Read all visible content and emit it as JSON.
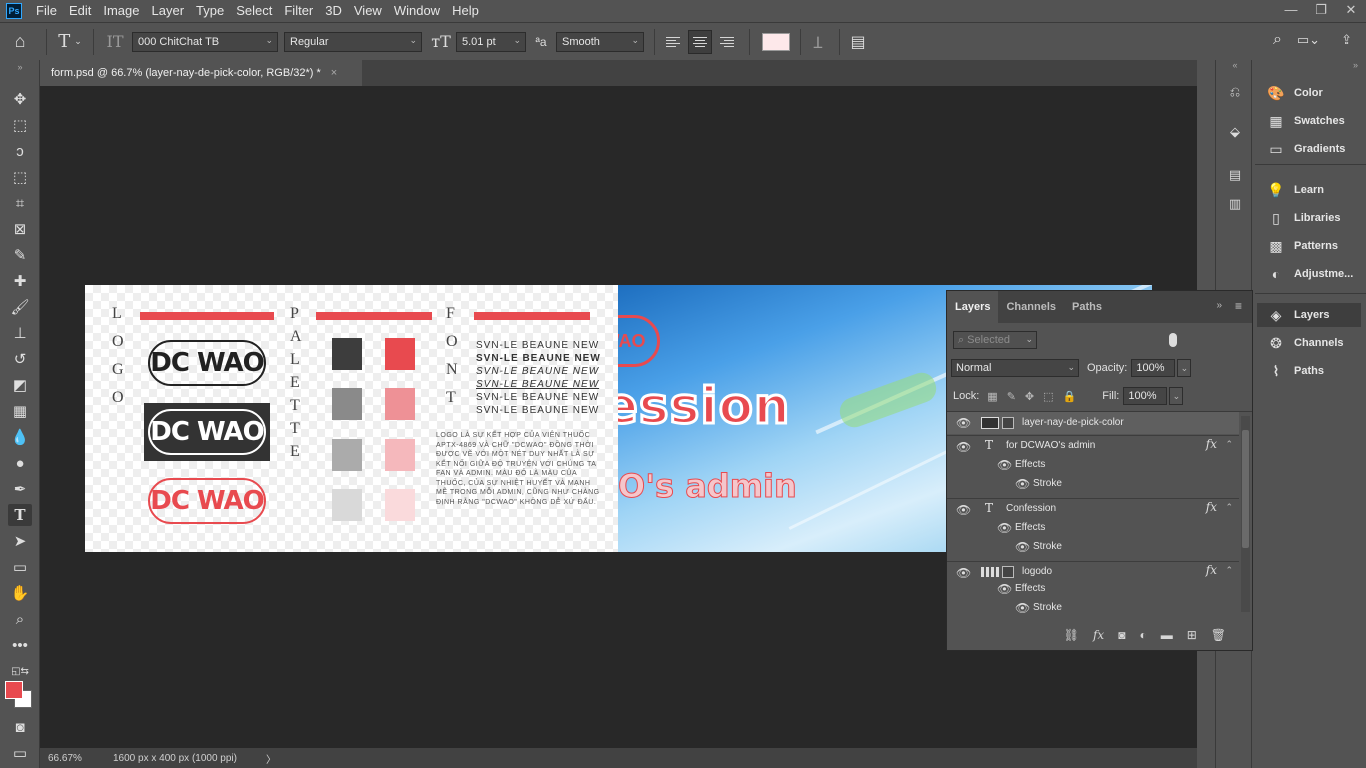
{
  "app": {
    "logo": "Ps"
  },
  "menu": [
    "File",
    "Edit",
    "Image",
    "Layer",
    "Type",
    "Select",
    "Filter",
    "3D",
    "View",
    "Window",
    "Help"
  ],
  "window_controls": {
    "minimize": "—",
    "restore": "❐",
    "close": "✕"
  },
  "options": {
    "font_family": "000 ChitChat TB",
    "font_style": "Regular",
    "font_size": "5.01 pt",
    "anti_alias": "Smooth",
    "aa_icon_label": "ªa",
    "text_color": "#fde8ea"
  },
  "document_tab": {
    "title": "form.psd @ 66.7% (layer-nay-de-pick-color, RGB/32*) *",
    "close": "×"
  },
  "status": {
    "zoom": "66.67%",
    "info": "1600 px x 400 px (1000 ppi)",
    "arrow": "〉"
  },
  "canvas": {
    "section_labels": {
      "logo": [
        "L",
        "O",
        "G",
        "O"
      ],
      "palette": [
        "P",
        "A",
        "L",
        "E",
        "T",
        "T",
        "E"
      ],
      "font": [
        "F",
        "O",
        "N",
        "T"
      ]
    },
    "logo_text": "DC WAO",
    "palette_gray": [
      "#3d3d3d",
      "#8a8a8a",
      "#ababab",
      "#d9d9d9"
    ],
    "palette_red": [
      "#e84a4f",
      "#ee9196",
      "#f5b8bc",
      "#fadadc"
    ],
    "font_samples": [
      "SVN-LE BEAUNE NEW",
      "SVN-LE BEAUNE NEW",
      "SVN-LE BEAUNE NEW",
      "SVN-LE BEAUNE NEW",
      "SVN-LE BEAUNE NEW",
      "SVN-LE BEAUNE NEW"
    ],
    "font_description": "Logo là sự kết hợp của viên thuốc APTX-4869 và chữ \"DCWAO\" đồng thời được vẽ với một nét duy nhất là sự kết nối giữa độ truyện với chúng ta fan và admin. Màu đỏ là màu của thuốc, của sự nhiệt huyết và mạnh mẽ trong mỗi admin, cũng như chàng định rằng \"DCWAO\" không dễ xứ đấu.",
    "right_logo": "WAO",
    "confession": "ession",
    "admin": "O's admin"
  },
  "right_panels": [
    {
      "icon": "palette-icon",
      "label": "Color"
    },
    {
      "icon": "swatches-icon",
      "label": "Swatches"
    },
    {
      "icon": "gradients-icon",
      "label": "Gradients"
    },
    {
      "icon": "learn-icon",
      "label": "Learn"
    },
    {
      "icon": "libraries-icon",
      "label": "Libraries"
    },
    {
      "icon": "patterns-icon",
      "label": "Patterns"
    },
    {
      "icon": "adjustments-icon",
      "label": "Adjustme..."
    },
    {
      "icon": "layers-icon",
      "label": "Layers"
    },
    {
      "icon": "channels-icon",
      "label": "Channels"
    },
    {
      "icon": "paths-icon",
      "label": "Paths"
    }
  ],
  "layers_panel": {
    "tabs": [
      "Layers",
      "Channels",
      "Paths"
    ],
    "filter_placeholder": "Selected",
    "blend_mode": "Normal",
    "opacity_label": "Opacity:",
    "opacity": "100%",
    "lock_label": "Lock:",
    "fill_label": "Fill:",
    "fill": "100%",
    "layers": [
      {
        "name": "layer-nay-de-pick-color",
        "type": "image",
        "effects": []
      },
      {
        "name": "for DCWAO's admin",
        "type": "text",
        "effects": [
          "Effects",
          "Stroke"
        ]
      },
      {
        "name": "Confession",
        "type": "text",
        "effects": [
          "Effects",
          "Stroke"
        ]
      },
      {
        "name": "logodo",
        "type": "image",
        "effects": [
          "Effects",
          "Stroke"
        ]
      }
    ],
    "fx_label": "fx"
  }
}
